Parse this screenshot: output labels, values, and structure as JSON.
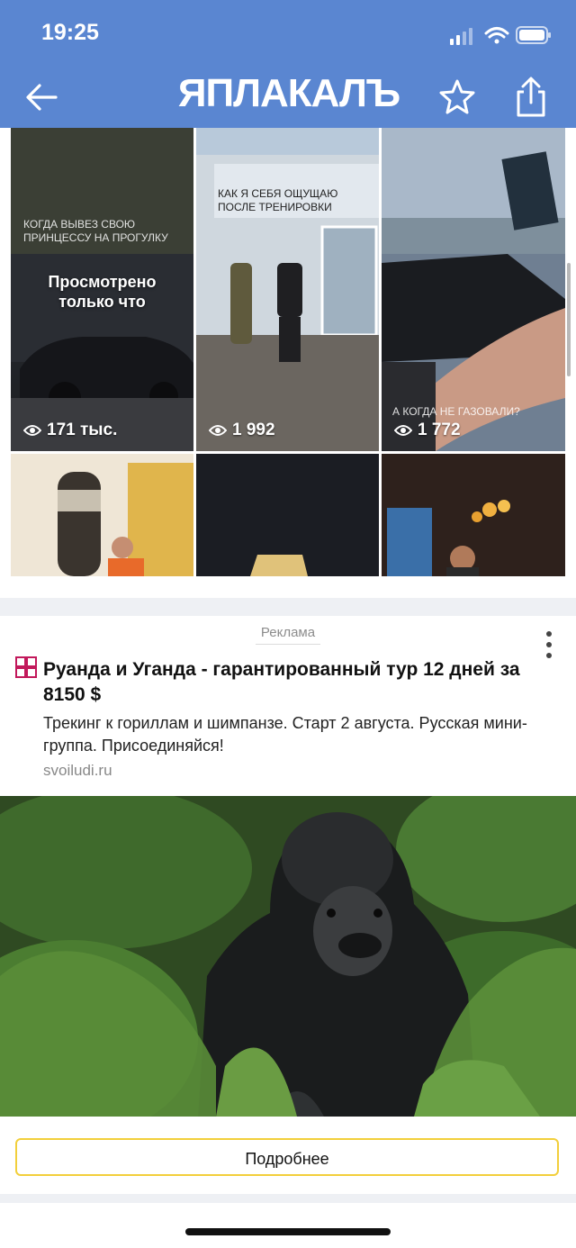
{
  "status_bar": {
    "time": "19:25"
  },
  "header": {
    "logo": "ЯПЛАКАЛЪ"
  },
  "grid": {
    "tiles": [
      {
        "caption": "КОГДА ВЫВЕЗ СВОЮ ПРИНЦЕССУ НА ПРОГУЛКУ",
        "overlay": "Просмотрено только что",
        "views": "171 тыс."
      },
      {
        "caption": "КАК Я СЕБЯ ОЩУЩАЮ ПОСЛЕ ТРЕНИРОВКИ",
        "views": "1 992"
      },
      {
        "caption": "А КОГДА НЕ ГАЗОВАЛИ?",
        "views": "1 772"
      }
    ]
  },
  "ad": {
    "label": "Реклама",
    "title": "Руанда и Уганда - гарантированный тур 12 дней за 8150 $",
    "text": "Трекинг к гориллам и шимпанзе. Старт 2 августа. Русская мини-группа. Присоединяйся!",
    "domain": "svoiludi.ru",
    "button": "Подробнее"
  },
  "colors": {
    "header": "#5a86d1",
    "button_border": "#f2cf3b"
  }
}
